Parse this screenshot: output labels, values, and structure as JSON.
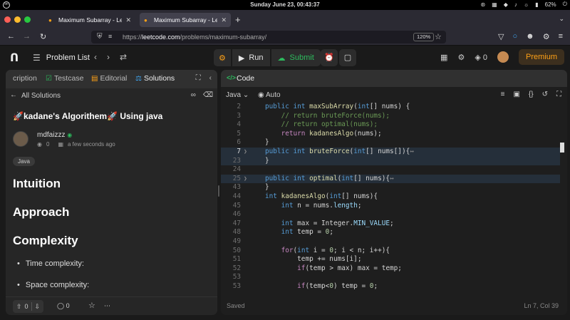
{
  "os": {
    "clock": "Sunday June 23, 00:43:37",
    "battery": "62%"
  },
  "browser": {
    "tabs": [
      {
        "title": "Maximum Subarray - LeetCo"
      },
      {
        "title": "Maximum Subarray - LeetCo"
      }
    ],
    "url_prefix": "https://",
    "url_host": "leetcode.com",
    "url_path": "/problems/maximum-subarray/",
    "zoom": "120%"
  },
  "header": {
    "problem_list": "Problem List",
    "run": "Run",
    "submit": "Submit",
    "streak": "0",
    "premium": "Premium"
  },
  "left": {
    "tabs": [
      {
        "label": "cription"
      },
      {
        "label": "Testcase"
      },
      {
        "label": "Editorial"
      },
      {
        "label": "Solutions"
      }
    ],
    "all_solutions": "All Solutions",
    "solution_title": "🚀kadane's Algorithem🚀 Using java",
    "author": "mdfaizzz",
    "views": "0",
    "posted": "a few seconds ago",
    "tag": "Java",
    "headings": [
      "Intuition",
      "Approach",
      "Complexity"
    ],
    "bullets": [
      "Time complexity:",
      "Space complexity:"
    ],
    "footer": {
      "upvotes": "0",
      "comments": "0"
    }
  },
  "right": {
    "panel_title": "Code",
    "language": "Java",
    "mode": "Auto",
    "status": "Saved",
    "cursor": "Ln 7, Col 39"
  },
  "code_lines": [
    {
      "n": "2"
    },
    {
      "n": "3"
    },
    {
      "n": "4"
    },
    {
      "n": "5"
    },
    {
      "n": "6"
    },
    {
      "n": "7"
    },
    {
      "n": "23"
    },
    {
      "n": "24"
    },
    {
      "n": "25"
    },
    {
      "n": "43"
    },
    {
      "n": "44"
    },
    {
      "n": "45"
    },
    {
      "n": "46"
    },
    {
      "n": "47"
    },
    {
      "n": "48"
    },
    {
      "n": "49"
    },
    {
      "n": "50"
    },
    {
      "n": "51"
    },
    {
      "n": "52"
    },
    {
      "n": "53"
    }
  ],
  "code_tokens": {
    "l2_kw": "public int ",
    "l2_fn": "maxSubArray",
    "l2_p": "(",
    "l2_ty": "int",
    "l2_rest": "[] nums) {",
    "l3": "// return bruteForce(nums);",
    "l4": "// return optimal(nums);",
    "l5_kw": "return ",
    "l5_fn": "kadanesAlgo",
    "l5_rest": "(nums);",
    "l6": "}",
    "l7_kw": "public int ",
    "l7_fn": "bruteForce",
    "l7_p": "(",
    "l7_ty": "int",
    "l7_rest": "[] nums[]){",
    "l7_fold": "↔",
    "l23": "}",
    "l25_kw": "public int ",
    "l25_fn": "optimal",
    "l25_p": "(",
    "l25_ty": "int",
    "l25_rest": "[] nums){",
    "l25_fold": "↔",
    "l43": "}",
    "l44_ty": "int ",
    "l44_fn": "kadanesAlgo",
    "l44_p": "(",
    "l44_ty2": "int",
    "l44_rest": "[] nums){",
    "l45_ty": "int ",
    "l45_rest": "n = nums.",
    "l45_fd": "length",
    "l45_end": ";",
    "l47_ty": "int ",
    "l47_rest": "max = Integer.",
    "l47_fd": "MIN_VALUE",
    "l47_end": ";",
    "l48_ty": "int ",
    "l48_rest": "temp = ",
    "l48_nm": "0",
    "l48_end": ";",
    "l50_kw": "for",
    "l50_p": "(",
    "l50_ty": "int ",
    "l50_a": "i = ",
    "l50_nm": "0",
    "l50_rest": "; i < n; i++){",
    "l51": "temp += nums[i];",
    "l52_kw": "if",
    "l52_rest": "(temp > max) max = temp;",
    "l54_kw": "if",
    "l54_a": "(temp<",
    "l54_nm": "0",
    "l54_rest": ") temp = ",
    "l54_nm2": "0",
    "l54_end": ";"
  },
  "colors": {
    "accent": "#ffa116",
    "success": "#2cbb5d",
    "editor_bg": "#1e1e1e"
  }
}
